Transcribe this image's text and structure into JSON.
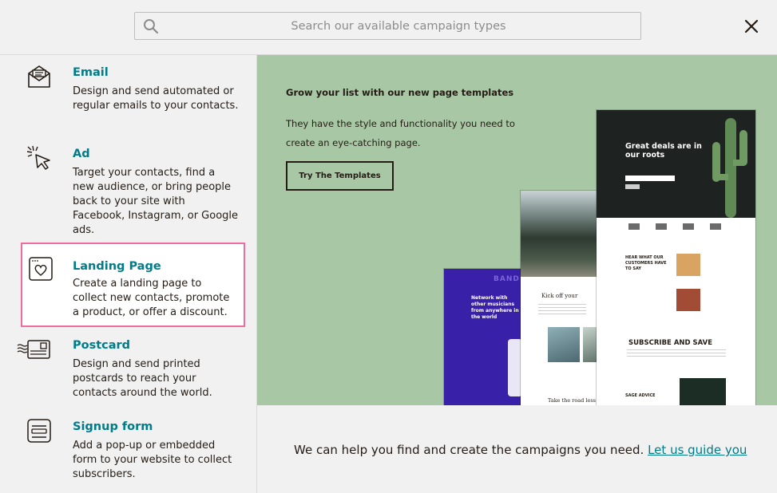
{
  "search": {
    "placeholder": "Search our available campaign types",
    "value": ""
  },
  "campaigns": [
    {
      "title": "Email",
      "desc": "Design and send automated or regular emails to your contacts.",
      "icon": "envelope-icon"
    },
    {
      "title": "Ad",
      "desc": "Target your contacts, find a new audience, or bring people back to your site with Facebook, Instagram, or Google ads.",
      "icon": "cursor-click-icon"
    },
    {
      "title": "Landing Page",
      "desc": "Create a landing page to collect new contacts, promote a product, or offer a discount.",
      "icon": "heart-page-icon",
      "selected": true
    },
    {
      "title": "Postcard",
      "desc": "Design and send printed postcards to reach your contacts around the world.",
      "icon": "postcard-icon"
    },
    {
      "title": "Signup form",
      "desc": "Add a pop-up or embedded form to your website to collect subscribers.",
      "icon": "form-icon"
    }
  ],
  "promo": {
    "headline": "Grow your list with our new page templates",
    "body": "They have the style and functionality you need to create an eye-catching page.",
    "button": "Try The Templates",
    "templates": {
      "band_heading": "BAND",
      "band_text": "Network with other musicians from anywhere in the world",
      "kick_off": "Kick off your",
      "take_road": "Take the road less",
      "deals_title": "Great deals are in our roots",
      "testimonials_title": "HEAR WHAT OUR CUSTOMERS HAVE TO SAY",
      "subscribe_title": "SUBSCRIBE AND SAVE",
      "advice_title": "SAGE ADVICE"
    }
  },
  "footer": {
    "text": "We can help you find and create the campaigns you need.",
    "link": "Let us guide you"
  },
  "colors": {
    "accent": "#007c89",
    "selected_border": "#ee6c9f",
    "promo_bg": "#a8c7a4",
    "band_bg": "#3820a8"
  }
}
